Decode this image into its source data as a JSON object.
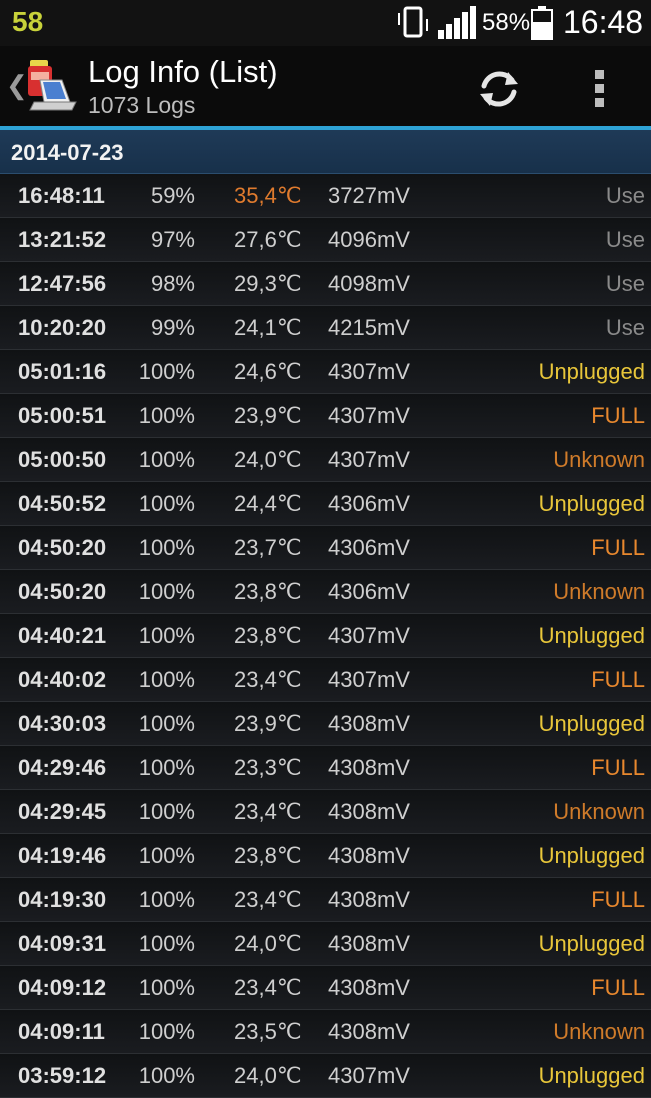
{
  "statusbar": {
    "notification_number": "58",
    "battery_percent": "58%",
    "time": "16:48"
  },
  "actionbar": {
    "title": "Log Info (List)",
    "subtitle": "1073 Logs",
    "icons": [
      "back-caret-icon",
      "battery-laptop-app-icon",
      "refresh-icon",
      "overflow-menu-icon"
    ]
  },
  "section": {
    "date": "2014-07-23"
  },
  "colors": {
    "accent": "#2ea3d6",
    "use": "#8a8a8a",
    "unplugged": "#e8c63a",
    "full": "#e8882e",
    "unknown": "#cf7b2a",
    "hot_temp": "#e07b2e"
  },
  "logs": [
    {
      "time": "16:48:11",
      "pct": "59%",
      "temp": "35,4℃",
      "volt": "3727mV",
      "status": "Use",
      "hot": true
    },
    {
      "time": "13:21:52",
      "pct": "97%",
      "temp": "27,6℃",
      "volt": "4096mV",
      "status": "Use"
    },
    {
      "time": "12:47:56",
      "pct": "98%",
      "temp": "29,3℃",
      "volt": "4098mV",
      "status": "Use"
    },
    {
      "time": "10:20:20",
      "pct": "99%",
      "temp": "24,1℃",
      "volt": "4215mV",
      "status": "Use"
    },
    {
      "time": "05:01:16",
      "pct": "100%",
      "temp": "24,6℃",
      "volt": "4307mV",
      "status": "Unplugged"
    },
    {
      "time": "05:00:51",
      "pct": "100%",
      "temp": "23,9℃",
      "volt": "4307mV",
      "status": "FULL"
    },
    {
      "time": "05:00:50",
      "pct": "100%",
      "temp": "24,0℃",
      "volt": "4307mV",
      "status": "Unknown"
    },
    {
      "time": "04:50:52",
      "pct": "100%",
      "temp": "24,4℃",
      "volt": "4306mV",
      "status": "Unplugged"
    },
    {
      "time": "04:50:20",
      "pct": "100%",
      "temp": "23,7℃",
      "volt": "4306mV",
      "status": "FULL"
    },
    {
      "time": "04:50:20",
      "pct": "100%",
      "temp": "23,8℃",
      "volt": "4306mV",
      "status": "Unknown"
    },
    {
      "time": "04:40:21",
      "pct": "100%",
      "temp": "23,8℃",
      "volt": "4307mV",
      "status": "Unplugged"
    },
    {
      "time": "04:40:02",
      "pct": "100%",
      "temp": "23,4℃",
      "volt": "4307mV",
      "status": "FULL"
    },
    {
      "time": "04:30:03",
      "pct": "100%",
      "temp": "23,9℃",
      "volt": "4308mV",
      "status": "Unplugged"
    },
    {
      "time": "04:29:46",
      "pct": "100%",
      "temp": "23,3℃",
      "volt": "4308mV",
      "status": "FULL"
    },
    {
      "time": "04:29:45",
      "pct": "100%",
      "temp": "23,4℃",
      "volt": "4308mV",
      "status": "Unknown"
    },
    {
      "time": "04:19:46",
      "pct": "100%",
      "temp": "23,8℃",
      "volt": "4308mV",
      "status": "Unplugged"
    },
    {
      "time": "04:19:30",
      "pct": "100%",
      "temp": "23,4℃",
      "volt": "4308mV",
      "status": "FULL"
    },
    {
      "time": "04:09:31",
      "pct": "100%",
      "temp": "24,0℃",
      "volt": "4308mV",
      "status": "Unplugged"
    },
    {
      "time": "04:09:12",
      "pct": "100%",
      "temp": "23,4℃",
      "volt": "4308mV",
      "status": "FULL"
    },
    {
      "time": "04:09:11",
      "pct": "100%",
      "temp": "23,5℃",
      "volt": "4308mV",
      "status": "Unknown"
    },
    {
      "time": "03:59:12",
      "pct": "100%",
      "temp": "24,0℃",
      "volt": "4307mV",
      "status": "Unplugged"
    }
  ]
}
